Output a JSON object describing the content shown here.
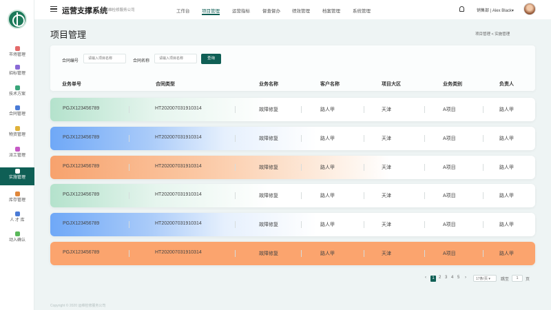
{
  "app": {
    "title": "运营支撑系统",
    "subtitle": "4 运维检修服务公司"
  },
  "nav": [
    "工作台",
    "项目管理",
    "运营指标",
    "督查督办",
    "绩效管理",
    "档案管理",
    "系统管理"
  ],
  "user": {
    "label": "销售部 | Alex Black▾"
  },
  "sidebar": [
    {
      "label": "市场管理",
      "color": "#e46a6a"
    },
    {
      "label": "招标管理",
      "color": "#8a6ad6"
    },
    {
      "label": "技术方案",
      "color": "#3aa57a"
    },
    {
      "label": "合同管理",
      "color": "#4a7bd6"
    },
    {
      "label": "物资管理",
      "color": "#e0b23a"
    },
    {
      "label": "派工管理",
      "color": "#c65ac6"
    },
    {
      "label": "实施管理",
      "color": "#ffffff"
    },
    {
      "label": "库存管理",
      "color": "#e0873a"
    },
    {
      "label": "人 才 库",
      "color": "#4a7bd6"
    },
    {
      "label": "动入确认",
      "color": "#5ab85a"
    }
  ],
  "page": {
    "title": "项目管理",
    "breadcrumb": "项目管理  <  实施管理"
  },
  "filter": {
    "contract_no_label": "合同编号",
    "contract_no_placeholder": "请输入项目名称",
    "contract_name_label": "合同名称",
    "contract_name_placeholder": "请输入项目名称",
    "search_label": "查询"
  },
  "table": {
    "headers": [
      "业务单号",
      "合同类型",
      "业务名称",
      "客户名称",
      "项目大区",
      "业务类别",
      "负责人"
    ],
    "rows": [
      {
        "style": "green",
        "cells": [
          "PGJX123456789",
          "HT202007031910314",
          "故障修复",
          "路人甲",
          "天津",
          "A项目",
          "路人甲"
        ]
      },
      {
        "style": "blue",
        "cells": [
          "PGJX123456789",
          "HT202007031910314",
          "故障修复",
          "路人甲",
          "天津",
          "A项目",
          "路人甲"
        ]
      },
      {
        "style": "orange",
        "cells": [
          "PGJX123456789",
          "HT202007031910314",
          "故障修复",
          "路人甲",
          "天津",
          "A项目",
          "路人甲"
        ]
      },
      {
        "style": "green",
        "cells": [
          "PGJX123456789",
          "HT202007031910314",
          "故障修复",
          "路人甲",
          "天津",
          "A项目",
          "路人甲"
        ]
      },
      {
        "style": "blue",
        "cells": [
          "PGJX123456789",
          "HT202007031910314",
          "故障修复",
          "路人甲",
          "天津",
          "A项目",
          "路人甲"
        ]
      },
      {
        "style": "orange-full",
        "cells": [
          "PGJX123456789",
          "HT202007031910314",
          "故障修复",
          "路人甲",
          "天津",
          "A项目",
          "路人甲"
        ]
      }
    ]
  },
  "pagination": {
    "prev": "‹",
    "pages": [
      "1",
      "2",
      "3",
      "4",
      "5"
    ],
    "current": "1",
    "next": "›",
    "page_size": "17条/页 ▾",
    "goto_label": "跳至",
    "goto_value": "1",
    "page_unit": "页"
  },
  "footer": "Copyright © 2020 运维检修服务公司"
}
